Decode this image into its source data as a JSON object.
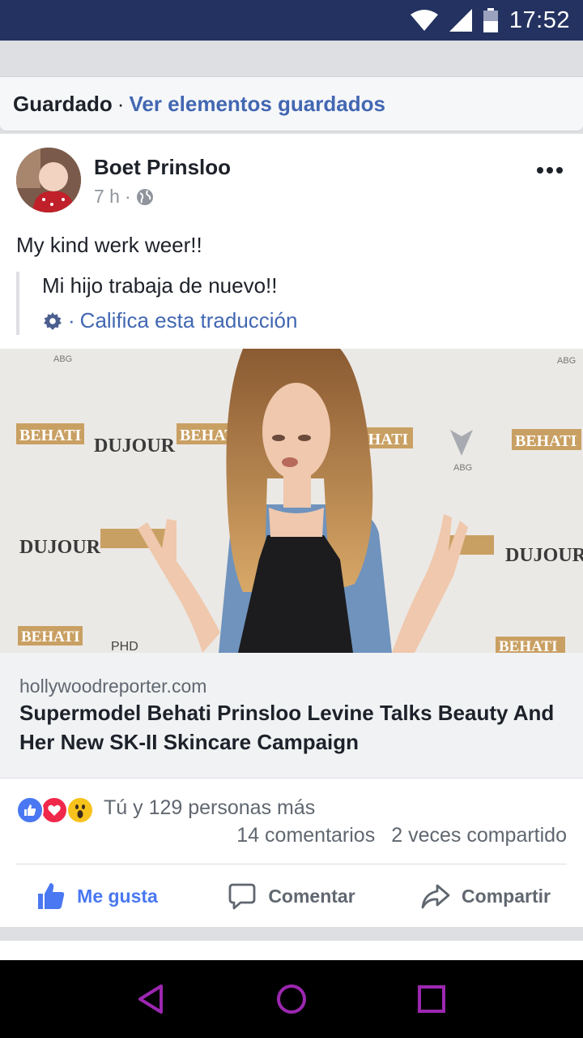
{
  "status_bar": {
    "time": "17:52"
  },
  "saved_banner": {
    "title": "Guardado",
    "separator": "·",
    "link": "Ver elementos guardados"
  },
  "post": {
    "author": "Boet Prinsloo",
    "time": "7 h",
    "meta_separator": "·",
    "text": "My kind werk weer!!",
    "translation": {
      "text": "Mi hijo trabaja de nuevo!!",
      "separator": "·",
      "rate_link": "Califica esta traducción"
    },
    "link": {
      "domain": "hollywoodreporter.com",
      "title": "Supermodel Behati Prinsloo Levine Talks Beauty And Her New SK-II Skincare Campaign",
      "backdrop_words": [
        "BEHATI",
        "DUJOUR",
        "ABG",
        "PHD"
      ]
    },
    "reactions": {
      "summary": "Tú y 129 personas más",
      "comments": "14 comentarios",
      "shares": "2 veces compartido"
    },
    "actions": {
      "like": "Me gusta",
      "comment": "Comentar",
      "share": "Compartir"
    }
  },
  "colors": {
    "status_bar": "#233260",
    "link_blue": "#4267b2",
    "like_blue": "#4a78f2",
    "nav_icon": "#9c27b0"
  }
}
